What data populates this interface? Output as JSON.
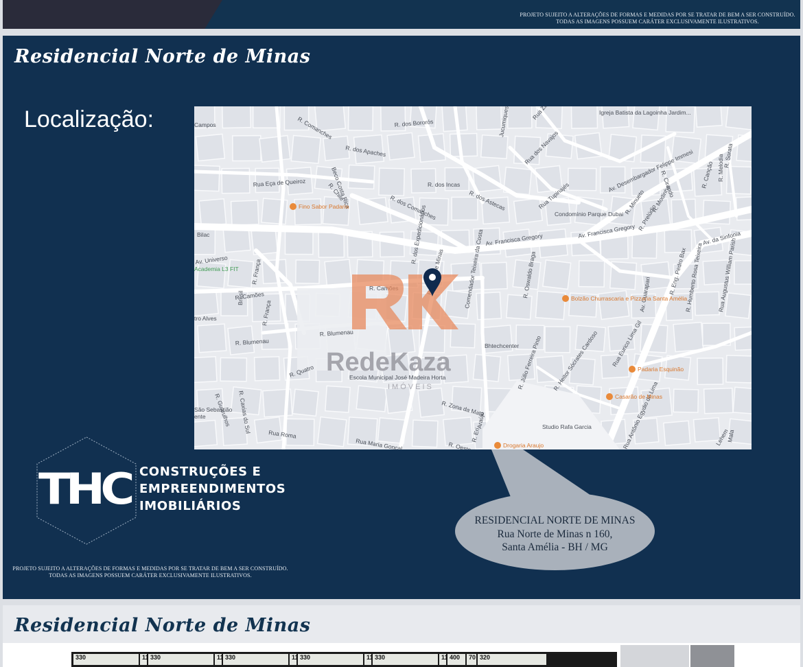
{
  "disclaimer": {
    "line1": "PROJETO SUJEITO A ALTERAÇÕES DE FORMAS E MEDIDAS POR SE TRATAR DE BEM A SER CONSTRUÍDO.",
    "line2": "TODAS AS IMAGENS POSSUEM CARÁTER EXCLUSIVAMENTE ILUSTRATIVOS."
  },
  "slide": {
    "title": "Residencial Norte de Minas",
    "location_label": "Localização:"
  },
  "map": {
    "streets": [
      "R. dos Bororós",
      "R. dos Apaches",
      "R. Comanches",
      "Rua Eça de Queiroz",
      "R. Chile",
      "R. dos Incas",
      "R. dos Comanches",
      "R. dos Astecas",
      "Rua dos Navajos",
      "Rua Tupinajés",
      "Av. Desembargador Felippe Immesi",
      "R. Cirando",
      "R. Canção",
      "R. Sorata",
      "R. Melodia",
      "R. Minueto",
      "R. Modinha",
      "R. Prelúdio",
      "Av. Francisca Gregory",
      "Av. Francisca Gregory",
      "Av. da Sinfonia",
      "Av. Universo",
      "R. França",
      "R. França",
      "R. Camões",
      "R. Camões",
      "R. dos Expedicionários",
      "R. Norte de Minas",
      "Comendador Teixeira da Costa",
      "R. Oswaldo Braga",
      "Av. Guarapari",
      "R. Eng. Pedro Bax",
      "R. Humberto Rosa Teixeira",
      "Rua Augustus William Parish",
      "R. Blumenau",
      "R. Blumenau",
      "R. Quatro",
      "R. Zona da Mata",
      "R. Júlio Ferreira Pinto",
      "R. Heitor Sócrates Cardoso",
      "Rua Eurico Lima Gil",
      "Rua Antônio Egydio de Lima",
      "Rua Maria Gonçal",
      "Rua Roma",
      "R. Guarulhos",
      "R. Caxias do Sul",
      "Campos",
      "Brasil",
      "Bilac",
      "tro Alves",
      "Rua Zapotecas",
      "Jucumiques",
      "Beco Costa Rica",
      "R. Oeste",
      "R. Eri",
      "Araújo",
      "Mala",
      "Lehem"
    ],
    "pois": [
      "Fino Sabor Padaria",
      "Bolzão Churrascaria e Pizzaria Santa Amélia",
      "Padaria Esquinão",
      "Casarão de Minas",
      "Drogaria Araujo"
    ],
    "places": [
      "Igreja Batista da Lagoinha Jardim...",
      "Condomínio Parque Dubai",
      "Bhtechcenter",
      "Escola Municipal José Madeira Horta",
      "Studio Rafa Garcia",
      "São Sebastião",
      "ente"
    ],
    "gym": "Academia L3 FIT",
    "watermark_brand": "RedeKaza",
    "watermark_sub": "IMÓVEIS",
    "marker": "map-pin-icon"
  },
  "company": {
    "logo_mark": "THC",
    "line1": "CONSTRUÇÕES E",
    "line2": "EMPREENDIMENTOS",
    "line3": "IMOBILIÁRIOS"
  },
  "callout": {
    "line1": "RESIDENCIAL NORTE DE MINAS",
    "line2": "Rua Norte de Minas n 160,",
    "line3": "Santa Amélia - BH / MG"
  },
  "slide2": {
    "title": "Residencial Norte de Minas",
    "plan_labels": [
      "330",
      "11",
      "330",
      "11",
      "330",
      "11",
      "330",
      "11",
      "330",
      "11",
      "400",
      "70",
      "320"
    ]
  },
  "colors": {
    "slide_bg": "#113050",
    "accent_orange": "#e07a4a"
  }
}
